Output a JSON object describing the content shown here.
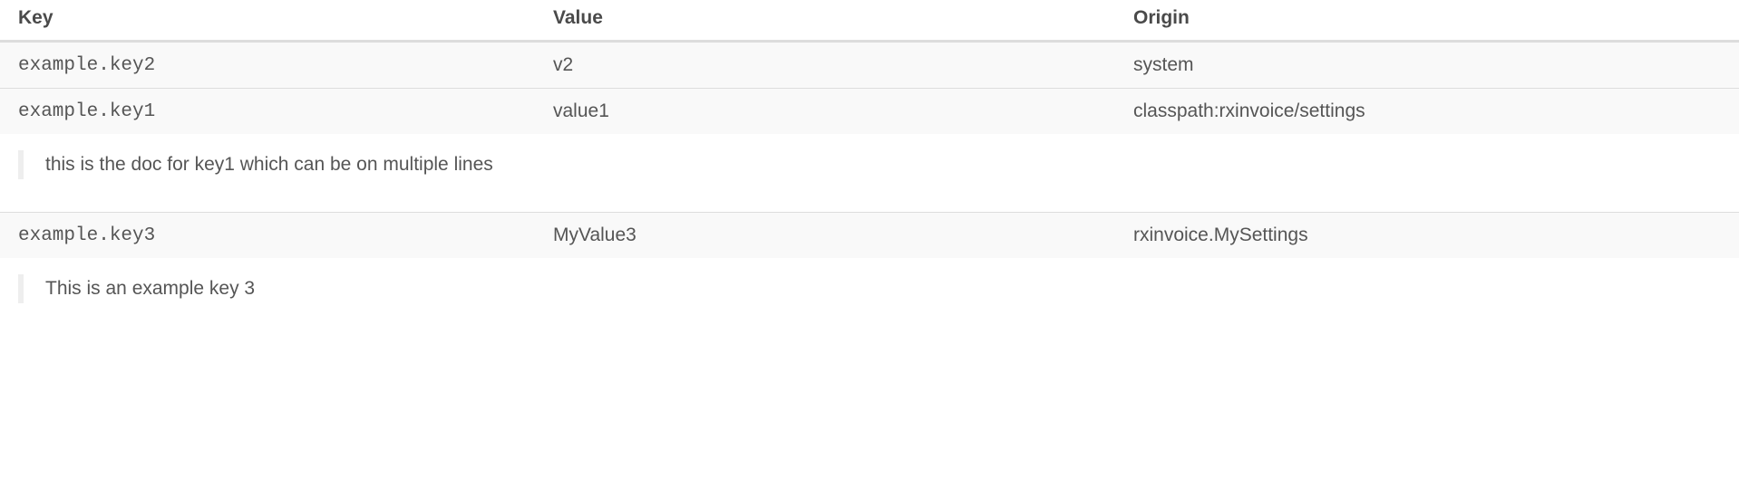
{
  "headers": {
    "key": "Key",
    "value": "Value",
    "origin": "Origin"
  },
  "rows": [
    {
      "key": "example.key2",
      "value": "v2",
      "origin": "system",
      "doc": null
    },
    {
      "key": "example.key1",
      "value": "value1",
      "origin": "classpath:rxinvoice/settings",
      "doc": "this is the doc for key1 which can be on multiple lines"
    },
    {
      "key": "example.key3",
      "value": "MyValue3",
      "origin": "rxinvoice.MySettings",
      "doc": "This is an example key 3"
    }
  ]
}
